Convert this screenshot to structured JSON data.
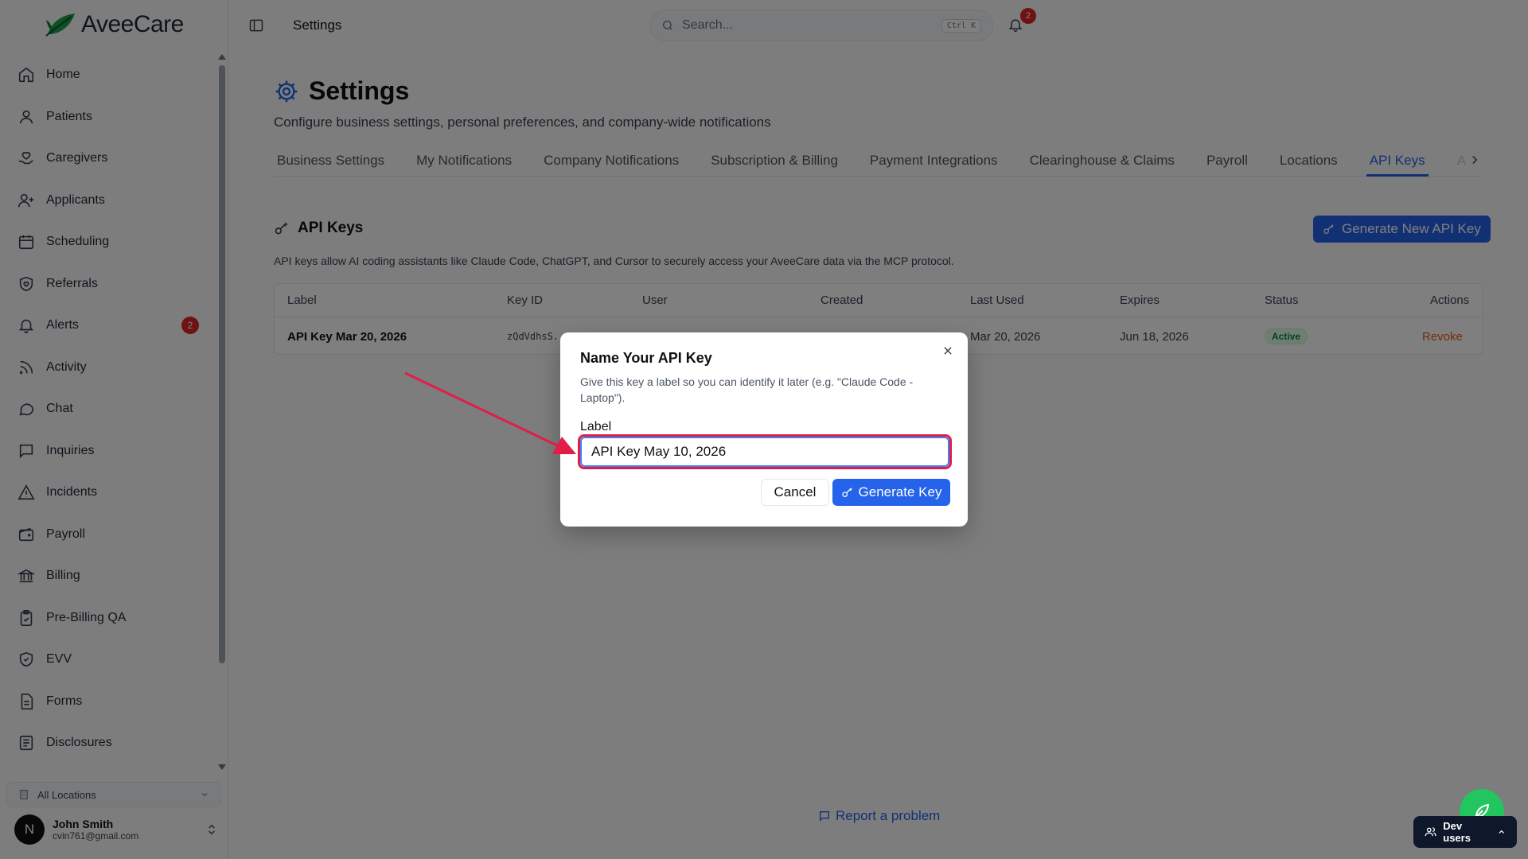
{
  "brand": {
    "name": "AveeCare",
    "accent": "#2563eb",
    "logo_green": "#16a34a"
  },
  "sidebar": {
    "items": [
      {
        "label": "Home",
        "icon": "home-icon"
      },
      {
        "label": "Patients",
        "icon": "user-icon"
      },
      {
        "label": "Caregivers",
        "icon": "heart-hand-icon"
      },
      {
        "label": "Applicants",
        "icon": "user-plus-icon"
      },
      {
        "label": "Scheduling",
        "icon": "calendar-icon"
      },
      {
        "label": "Referrals",
        "icon": "shield-heart-icon"
      },
      {
        "label": "Alerts",
        "icon": "bell-icon",
        "badge": "2"
      },
      {
        "label": "Activity",
        "icon": "rss-icon"
      },
      {
        "label": "Chat",
        "icon": "message-circle-icon"
      },
      {
        "label": "Inquiries",
        "icon": "message-square-icon"
      },
      {
        "label": "Incidents",
        "icon": "alert-triangle-icon"
      },
      {
        "label": "Payroll",
        "icon": "wallet-icon"
      },
      {
        "label": "Billing",
        "icon": "bank-icon"
      },
      {
        "label": "Pre-Billing QA",
        "icon": "clipboard-check-icon"
      },
      {
        "label": "EVV",
        "icon": "shield-check-icon"
      },
      {
        "label": "Forms",
        "icon": "file-icon"
      },
      {
        "label": "Disclosures",
        "icon": "file-text-icon"
      }
    ],
    "location_select": "All Locations",
    "user": {
      "initial": "N",
      "name": "John Smith",
      "email": "cvin761@gmail.com"
    }
  },
  "header": {
    "title": "Settings",
    "search_placeholder": "Search...",
    "search_shortcut": "Ctrl K",
    "notifications_count": "2"
  },
  "page": {
    "title": "Settings",
    "subtitle": "Configure business settings, personal preferences, and company-wide notifications",
    "tabs": [
      {
        "label": "Business Settings"
      },
      {
        "label": "My Notifications"
      },
      {
        "label": "Company Notifications"
      },
      {
        "label": "Subscription & Billing"
      },
      {
        "label": "Payment Integrations"
      },
      {
        "label": "Clearinghouse & Claims"
      },
      {
        "label": "Payroll"
      },
      {
        "label": "Locations"
      },
      {
        "label": "API Keys",
        "active": true
      }
    ],
    "tab_overflow": "A"
  },
  "api_keys": {
    "title": "API Keys",
    "generate_button": "Generate New API Key",
    "description": "API keys allow AI coding assistants like Claude Code, ChatGPT, and Cursor to securely access your AveeCare data via the MCP protocol.",
    "columns": [
      "Label",
      "Key ID",
      "User",
      "Created",
      "Last Used",
      "Expires",
      "Status",
      "Actions"
    ],
    "rows": [
      {
        "label": "API Key Mar 20, 2026",
        "key_id": "zQdVdhsS.",
        "last_used": "Mar 20, 2026",
        "expires": "Jun 18, 2026",
        "status": "Active",
        "action": "Revoke"
      }
    ]
  },
  "report_link": "Report a problem",
  "dev_users": "Dev users",
  "modal": {
    "title": "Name Your API Key",
    "description": "Give this key a label so you can identify it later (e.g. \"Claude Code - Laptop\").",
    "field_label": "Label",
    "field_value": "API Key May 10, 2026",
    "cancel": "Cancel",
    "confirm": "Generate Key",
    "annotation_color": "#e11d48"
  }
}
